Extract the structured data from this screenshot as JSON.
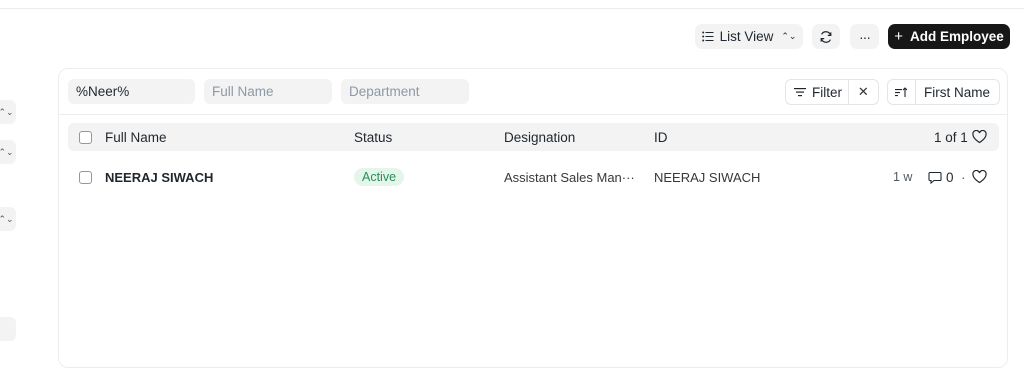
{
  "toolbar": {
    "list_view_label": "List View",
    "more_label": "···",
    "add_label": "Add Employee"
  },
  "filters": {
    "name_value": "%Neer%",
    "full_name_placeholder": "Full Name",
    "department_placeholder": "Department",
    "filter_label": "Filter",
    "sort_label": "First Name"
  },
  "table": {
    "columns": [
      "Full Name",
      "Status",
      "Designation",
      "ID"
    ],
    "count": "1 of 1",
    "rows": [
      {
        "full_name": "NEERAJ SIWACH",
        "status": "Active",
        "designation": "Assistant Sales Man···",
        "id": "NEERAJ SIWACH",
        "modified": "1 w",
        "comments": "0",
        "separator": "·"
      }
    ]
  },
  "colors": {
    "accent_dark": "#171717",
    "status_active_bg": "#e4f5e9",
    "status_active_text": "#278f5e"
  }
}
